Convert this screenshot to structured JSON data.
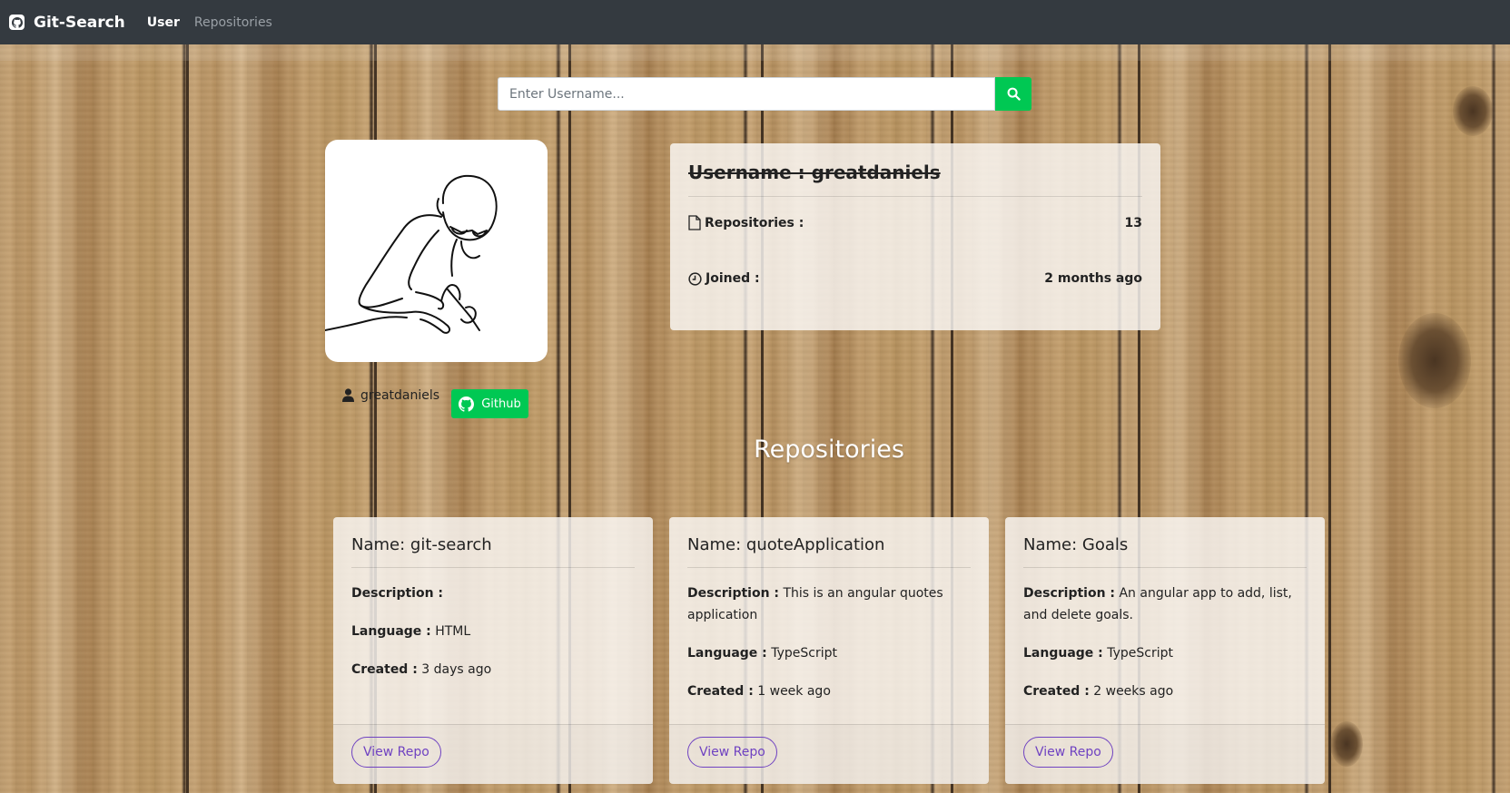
{
  "navbar": {
    "brand": "Git-Search",
    "links": [
      "User",
      "Repositories"
    ]
  },
  "search": {
    "placeholder": "Enter Username..."
  },
  "profile": {
    "username_display": "greatdaniels",
    "github_label": "Github",
    "info_title": "Username : greatdaniels",
    "repositories_label": "Repositories :",
    "repositories_count": "13",
    "joined_label": "Joined :",
    "joined_value": "2 months ago"
  },
  "section_title": "Repositories",
  "repos": [
    {
      "name": "Name: git-search",
      "description_label": "Description :",
      "description": "",
      "language_label": "Language :",
      "language": "HTML",
      "created_label": "Created :",
      "created": "3 days ago",
      "button": "View Repo"
    },
    {
      "name": "Name: quoteApplication",
      "description_label": "Description :",
      "description": "This is an angular quotes application",
      "language_label": "Language :",
      "language": "TypeScript",
      "created_label": "Created :",
      "created": "1 week ago",
      "button": "View Repo"
    },
    {
      "name": "Name: Goals",
      "description_label": "Description :",
      "description": "An angular app to add, list, and delete goals.",
      "language_label": "Language :",
      "language": "TypeScript",
      "created_label": "Created :",
      "created": "2 weeks ago",
      "button": "View Repo"
    }
  ],
  "colors": {
    "navbar_bg": "#343a40",
    "accent_green": "#00c853",
    "button_purple": "#6f42c1"
  },
  "icons": [
    "github-logo-icon",
    "search-icon",
    "user-icon",
    "github-icon",
    "file-icon",
    "clock-icon"
  ]
}
